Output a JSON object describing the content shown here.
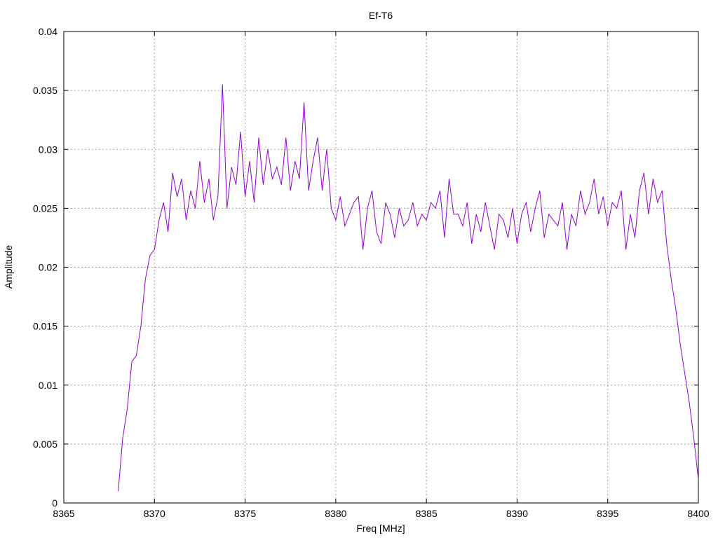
{
  "chart_data": {
    "type": "line",
    "title": "Ef-T6",
    "xlabel": "Freq [MHz]",
    "ylabel": "Amplitude",
    "xlim": [
      8365,
      8400
    ],
    "ylim": [
      0,
      0.04
    ],
    "x_ticks": [
      "8365",
      "8370",
      "8375",
      "8380",
      "8385",
      "8390",
      "8395",
      "8400"
    ],
    "y_ticks": [
      "0",
      "0.005",
      "0.01",
      "0.015",
      "0.02",
      "0.025",
      "0.03",
      "0.035",
      "0.04"
    ],
    "grid": true,
    "legend": "none",
    "line_color": "#9400d3",
    "series": [
      {
        "x": [
          8368.0,
          8368.25,
          8368.5,
          8368.75,
          8369.0,
          8369.25,
          8369.5,
          8369.75,
          8370.0,
          8370.25,
          8370.5,
          8370.75,
          8371.0,
          8371.25,
          8371.5,
          8371.75,
          8372.0,
          8372.25,
          8372.5,
          8372.75,
          8373.0,
          8373.25,
          8373.5,
          8373.75,
          8374.0,
          8374.25,
          8374.5,
          8374.75,
          8375.0,
          8375.25,
          8375.5,
          8375.75,
          8376.0,
          8376.25,
          8376.5,
          8376.75,
          8377.0,
          8377.25,
          8377.5,
          8377.75,
          8378.0,
          8378.25,
          8378.5,
          8378.75,
          8379.0,
          8379.25,
          8379.5,
          8379.75,
          8380.0,
          8380.25,
          8380.5,
          8380.75,
          8381.0,
          8381.25,
          8381.5,
          8381.75,
          8382.0,
          8382.25,
          8382.5,
          8382.75,
          8383.0,
          8383.25,
          8383.5,
          8383.75,
          8384.0,
          8384.25,
          8384.5,
          8384.75,
          8385.0,
          8385.25,
          8385.5,
          8385.75,
          8386.0,
          8386.25,
          8386.5,
          8386.75,
          8387.0,
          8387.25,
          8387.5,
          8387.75,
          8388.0,
          8388.25,
          8388.5,
          8388.75,
          8389.0,
          8389.25,
          8389.5,
          8389.75,
          8390.0,
          8390.25,
          8390.5,
          8390.75,
          8391.0,
          8391.25,
          8391.5,
          8391.75,
          8392.0,
          8392.25,
          8392.5,
          8392.75,
          8393.0,
          8393.25,
          8393.5,
          8393.75,
          8394.0,
          8394.25,
          8394.5,
          8394.75,
          8395.0,
          8395.25,
          8395.5,
          8395.75,
          8396.0,
          8396.25,
          8396.5,
          8396.75,
          8397.0,
          8397.25,
          8397.5,
          8397.75,
          8398.0,
          8398.25,
          8398.5,
          8398.75,
          8399.0,
          8399.25,
          8399.5,
          8399.75,
          8400.0
        ],
        "y": [
          0.001,
          0.0055,
          0.008,
          0.012,
          0.0125,
          0.015,
          0.019,
          0.021,
          0.0215,
          0.024,
          0.0255,
          0.023,
          0.028,
          0.026,
          0.0275,
          0.024,
          0.0265,
          0.025,
          0.029,
          0.0255,
          0.0275,
          0.024,
          0.026,
          0.0355,
          0.025,
          0.0285,
          0.027,
          0.0315,
          0.026,
          0.029,
          0.0255,
          0.031,
          0.027,
          0.03,
          0.0275,
          0.0285,
          0.027,
          0.031,
          0.0265,
          0.029,
          0.0275,
          0.034,
          0.0265,
          0.029,
          0.031,
          0.0265,
          0.03,
          0.025,
          0.024,
          0.026,
          0.0235,
          0.0245,
          0.0255,
          0.026,
          0.0215,
          0.025,
          0.0265,
          0.023,
          0.022,
          0.0255,
          0.0245,
          0.0225,
          0.025,
          0.0235,
          0.024,
          0.0255,
          0.0235,
          0.0245,
          0.024,
          0.0255,
          0.025,
          0.0265,
          0.0225,
          0.0275,
          0.0245,
          0.0245,
          0.0235,
          0.0255,
          0.022,
          0.0245,
          0.023,
          0.0255,
          0.0235,
          0.0215,
          0.0245,
          0.024,
          0.0225,
          0.025,
          0.022,
          0.0245,
          0.0255,
          0.023,
          0.025,
          0.0265,
          0.0225,
          0.0245,
          0.024,
          0.0235,
          0.0255,
          0.0215,
          0.0245,
          0.0235,
          0.0265,
          0.0245,
          0.0255,
          0.0275,
          0.0245,
          0.026,
          0.0235,
          0.0255,
          0.025,
          0.0265,
          0.0215,
          0.0245,
          0.0225,
          0.0265,
          0.028,
          0.0245,
          0.0275,
          0.0255,
          0.0265,
          0.022,
          0.019,
          0.0165,
          0.0135,
          0.011,
          0.0085,
          0.0055,
          0.002
        ]
      }
    ]
  }
}
